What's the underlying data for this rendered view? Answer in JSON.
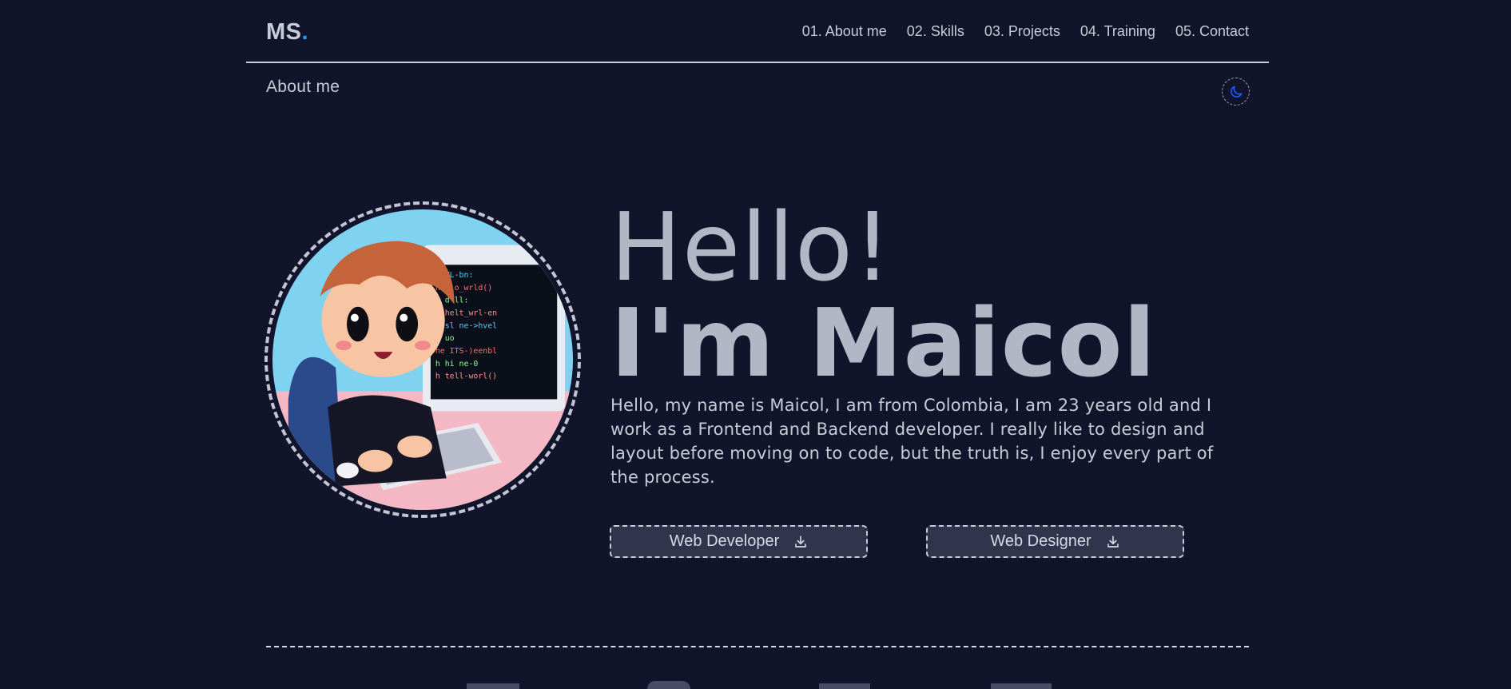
{
  "header": {
    "logo_text": "MS",
    "logo_dot": ".",
    "nav": [
      {
        "label": "01. About me"
      },
      {
        "label": "02. Skills"
      },
      {
        "label": "03. Projects"
      },
      {
        "label": "04. Training"
      },
      {
        "label": "05. Contact"
      }
    ]
  },
  "section": {
    "label": "About me"
  },
  "theme_toggle": {
    "icon": "moon-icon",
    "color": "#1e5bff"
  },
  "hero": {
    "greeting": "Hello!",
    "name": "I'm Maicol",
    "bio": "Hello, my name is Maicol, I am from Colombia, I am 23 years old and I work as a Frontend and Backend developer. I really like to design and layout before moving on to code, but the truth is, I enjoy every part of the process.",
    "buttons": [
      {
        "label": "Web Developer",
        "icon": "download-icon"
      },
      {
        "label": "Web Designer",
        "icon": "download-icon"
      }
    ]
  },
  "colors": {
    "background": "#11142a",
    "text": "#c9cbd6",
    "accent": "#1da1f2",
    "button_bg": "#32334d"
  }
}
